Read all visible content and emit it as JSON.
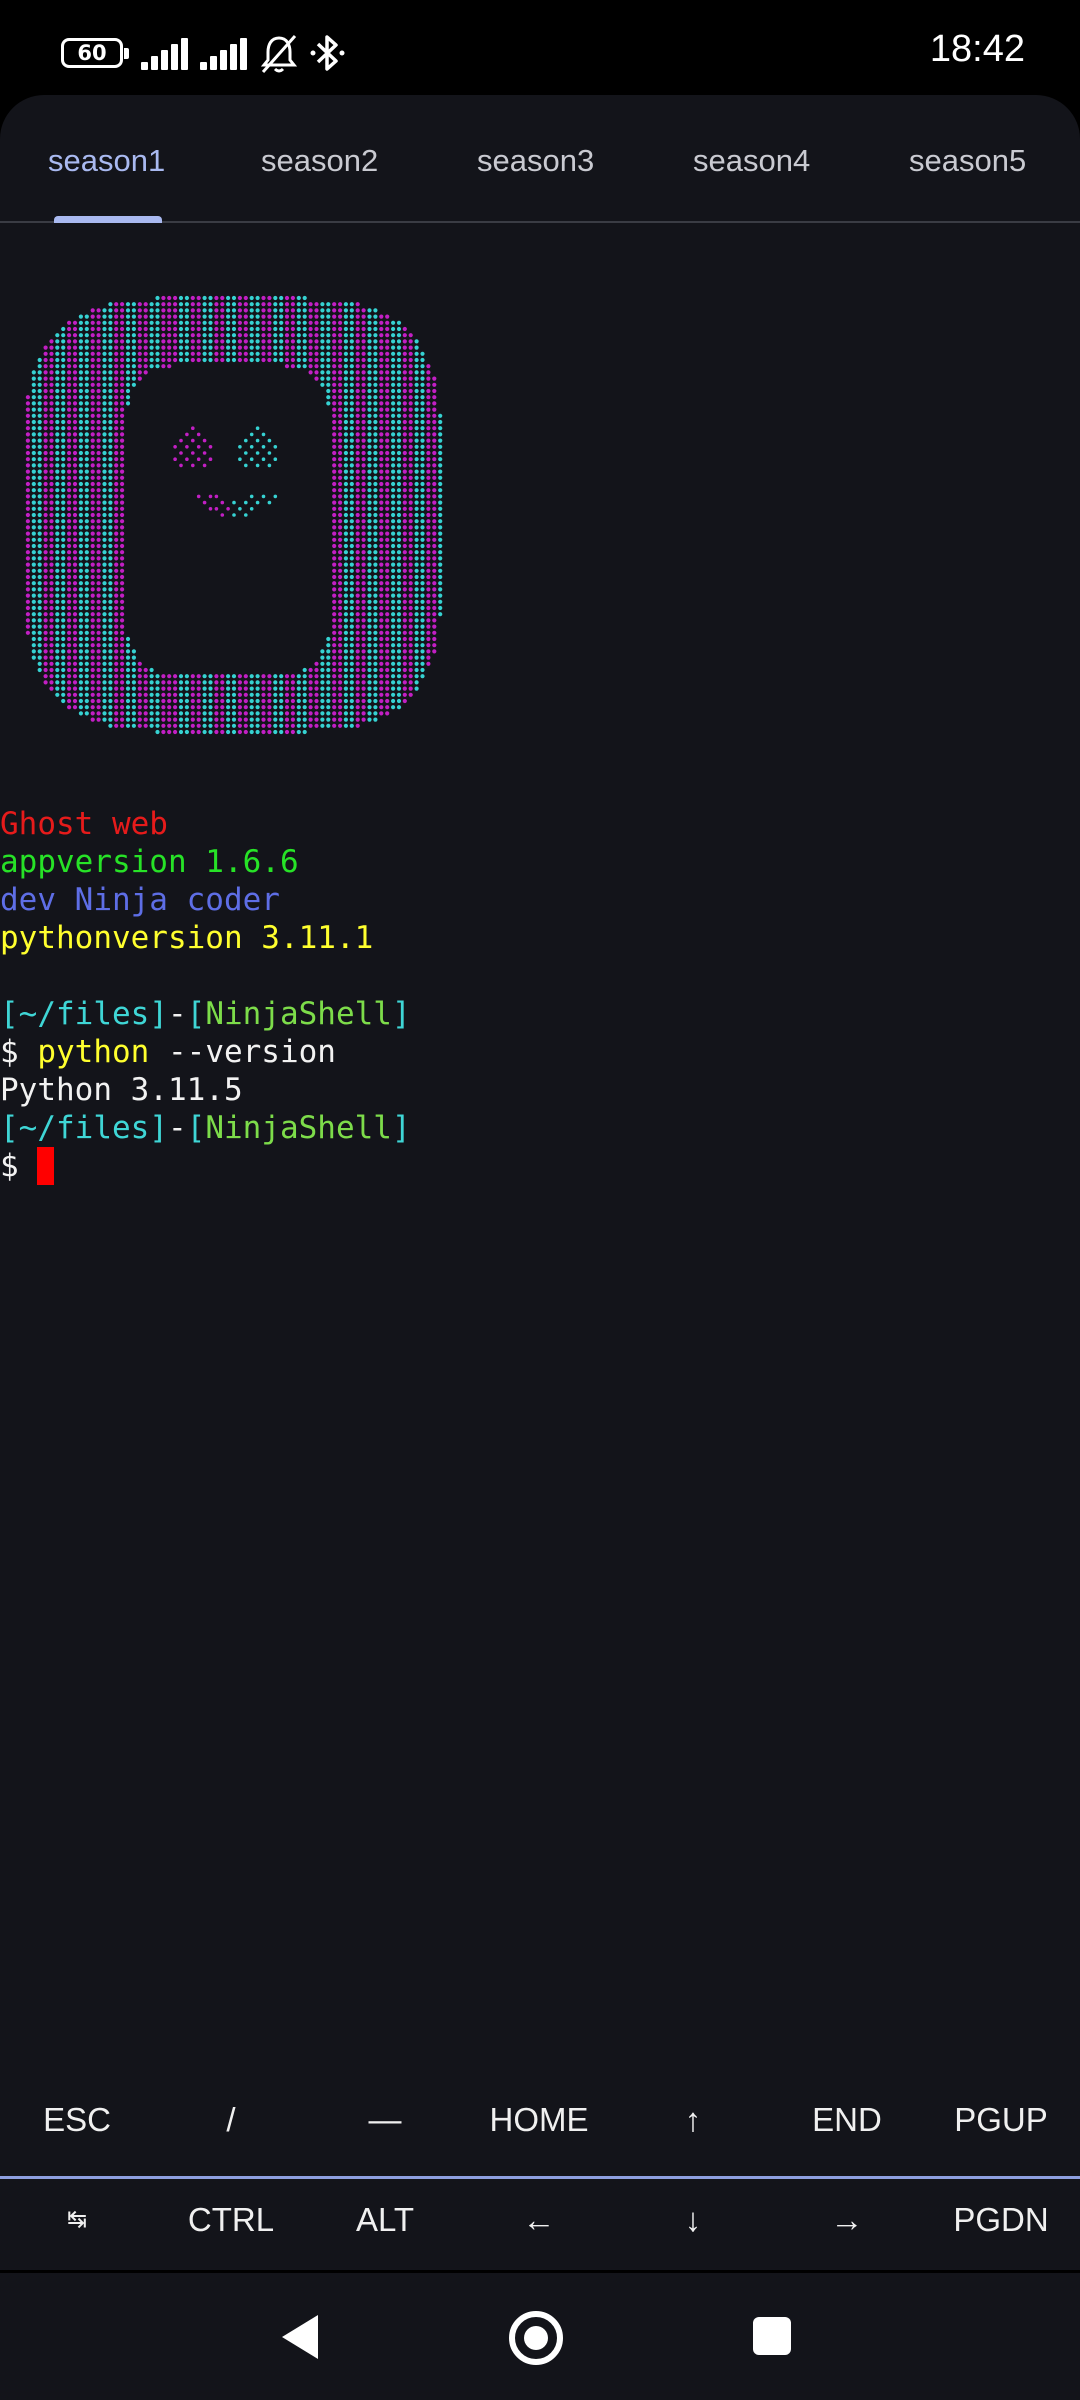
{
  "status_bar": {
    "battery": "60",
    "time": "18:42"
  },
  "tabs": [
    {
      "label": "season1",
      "active": true
    },
    {
      "label": "season2",
      "active": false
    },
    {
      "label": "season3",
      "active": false
    },
    {
      "label": "season4",
      "active": false
    },
    {
      "label": "season5",
      "active": false
    }
  ],
  "terminal": {
    "banner": {
      "name": "Ghost web",
      "appversion": "appversion 1.6.6",
      "dev": "dev Ninja coder",
      "pythonversion": "pythonversion 3.11.1"
    },
    "prompt_path": "[~/files]",
    "prompt_sep": "-",
    "prompt_shell": "[NinjaShell]",
    "prompt_symbol": "$",
    "command_name": "python",
    "command_args": " --version",
    "output": "Python 3.11.5"
  },
  "extra_keys": {
    "row1": [
      "ESC",
      "/",
      "—",
      "HOME",
      "↑",
      "END",
      "PGUP"
    ],
    "row2": [
      "↹",
      "CTRL",
      "ALT",
      "←",
      "↓",
      "→",
      "PGDN"
    ]
  },
  "colors": {
    "background": "#13141a",
    "accent": "#a9b9f0",
    "logo_magenta": "#c21fc4",
    "logo_cyan": "#36d2d2",
    "cursor": "#ff0000"
  }
}
